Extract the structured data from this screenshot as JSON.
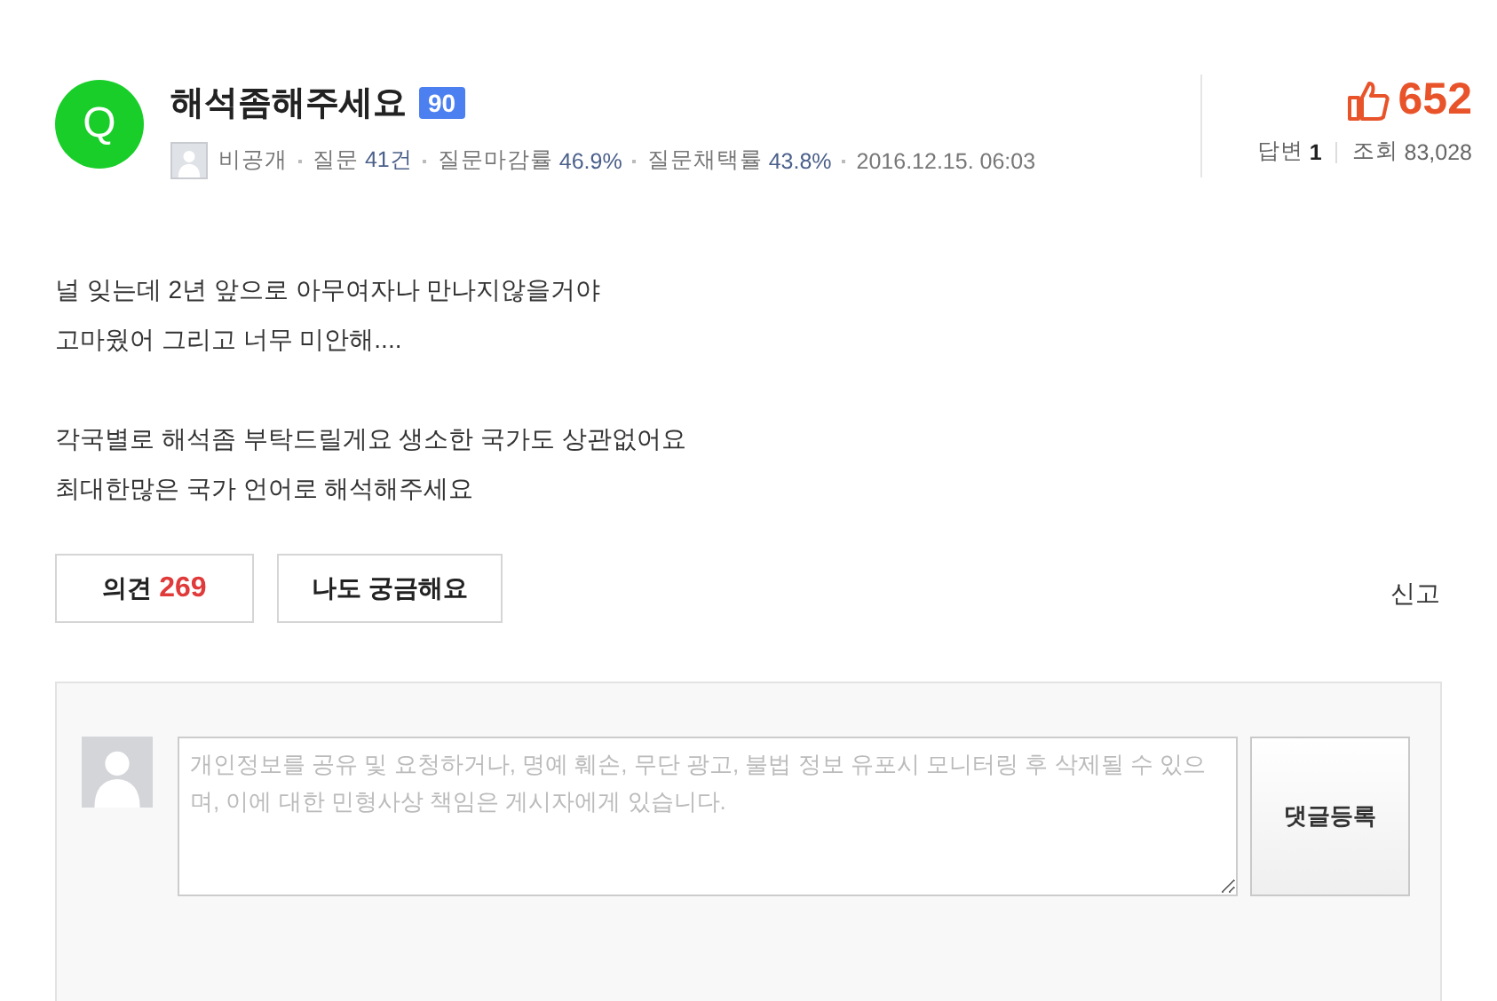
{
  "question": {
    "mark": "Q",
    "title": "해석좀해주세요",
    "points": "90",
    "author": "비공개",
    "stats": [
      {
        "label": "질문",
        "value": "41건"
      },
      {
        "label": "질문마감률",
        "value": "46.9%"
      },
      {
        "label": "질문채택률",
        "value": "43.8%"
      }
    ],
    "date": "2016.12.15. 06:03"
  },
  "summary": {
    "likes": "652",
    "answers_label": "답변",
    "answers": "1",
    "views_label": "조회",
    "views": "83,028"
  },
  "body": [
    [
      "널 잊는데 2년 앞으로 아무여자나 만나지않을거야",
      "고마웠어 그리고 너무 미안해...."
    ],
    [
      "각국별로 해석좀 부탁드릴게요 생소한 국가도 상관없어요",
      "최대한많은 국가 언어로 해석해주세요"
    ]
  ],
  "actions": {
    "opinion_label": "의견",
    "opinion_count": "269",
    "curious": "나도 궁금해요",
    "report": "신고"
  },
  "comment": {
    "placeholder": "개인정보를 공유 및 요청하거나, 명예 훼손, 무단 광고, 불법 정보 유포시 모니터링 후 삭제될 수 있으며, 이에 대한 민형사상 책임은 게시자에게 있습니다.",
    "submit": "댓글등록"
  }
}
